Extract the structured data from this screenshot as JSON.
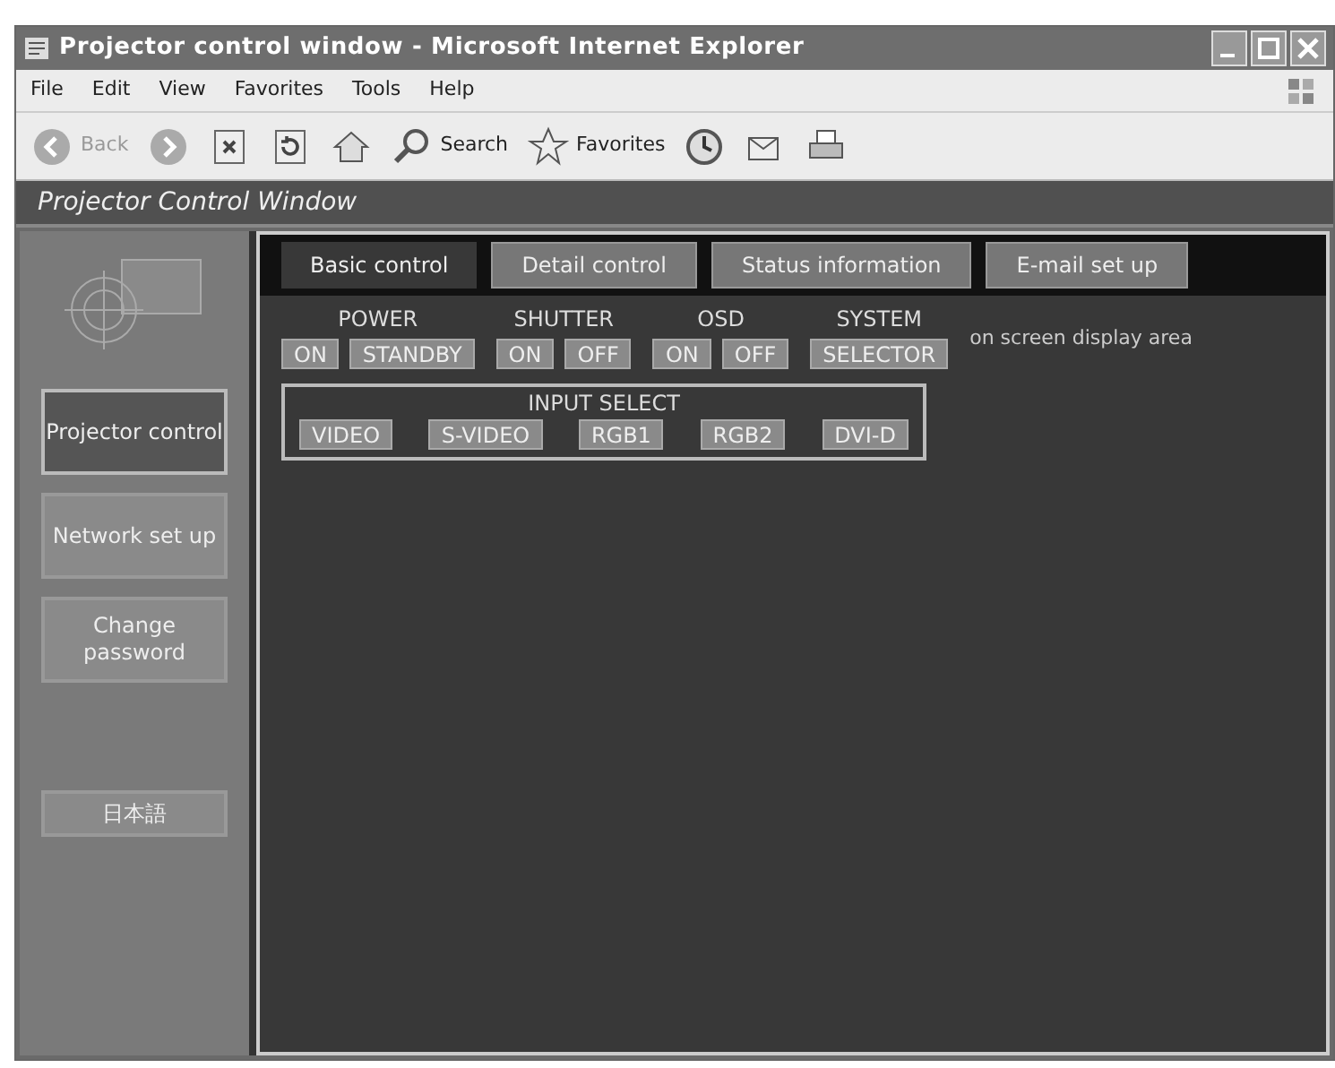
{
  "window": {
    "title": "Projector control window - Microsoft Internet Explorer"
  },
  "menu": [
    "File",
    "Edit",
    "View",
    "Favorites",
    "Tools",
    "Help"
  ],
  "toolbar": [
    {
      "kind": "back",
      "label": "Back"
    },
    {
      "kind": "forward"
    },
    {
      "kind": "stop"
    },
    {
      "kind": "refresh"
    },
    {
      "kind": "home"
    },
    {
      "kind": "search",
      "label": "Search"
    },
    {
      "kind": "favorites",
      "label": "Favorites"
    },
    {
      "kind": "history"
    },
    {
      "kind": "mail"
    },
    {
      "kind": "print"
    }
  ],
  "page_title": "Projector Control Window",
  "sidebar": {
    "buttons": [
      "Projector control",
      "Network set up",
      "Change password"
    ],
    "language_button": "日本語"
  },
  "tabs": [
    {
      "label": "Basic control",
      "selected": true
    },
    {
      "label": "Detail control",
      "selected": false
    },
    {
      "label": "Status information",
      "selected": false
    },
    {
      "label": "E-mail set up",
      "selected": false
    }
  ],
  "controls": [
    {
      "label": "POWER",
      "buttons": [
        "ON",
        "STANDBY"
      ]
    },
    {
      "label": "SHUTTER",
      "buttons": [
        "ON",
        "OFF"
      ]
    },
    {
      "label": "OSD",
      "buttons": [
        "ON",
        "OFF"
      ]
    },
    {
      "label": "SYSTEM",
      "buttons": [
        "SELECTOR"
      ]
    }
  ],
  "osd_note": "on screen display area",
  "input_select": {
    "title": "INPUT SELECT",
    "buttons": [
      "VIDEO",
      "S-VIDEO",
      "RGB1",
      "RGB2",
      "DVI-D"
    ]
  }
}
